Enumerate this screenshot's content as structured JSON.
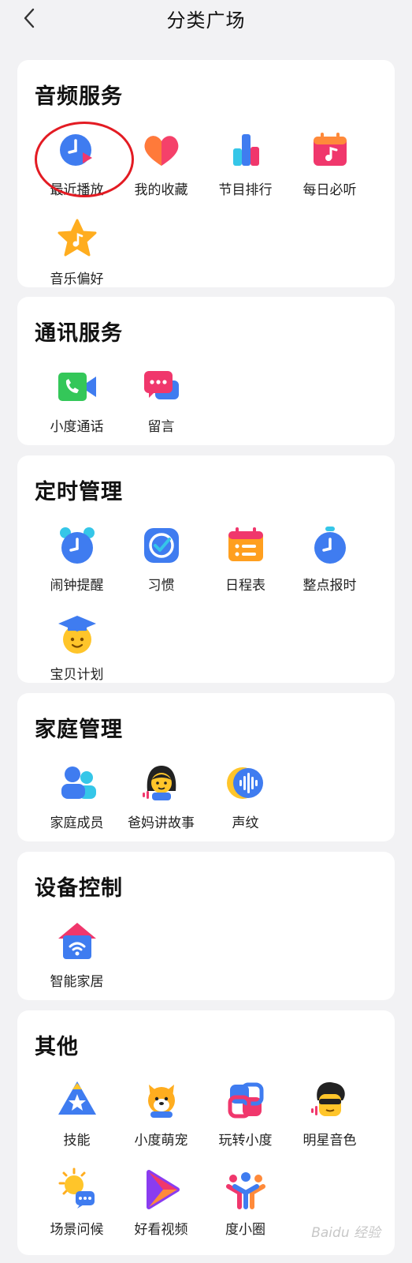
{
  "header": {
    "title": "分类广场"
  },
  "sections": [
    {
      "title": "音频服务",
      "items": [
        {
          "label": "最近播放",
          "icon": "clock-play-icon"
        },
        {
          "label": "我的收藏",
          "icon": "heart-icon"
        },
        {
          "label": "节目排行",
          "icon": "bar-chart-icon"
        },
        {
          "label": "每日必听",
          "icon": "calendar-music-icon"
        },
        {
          "label": "音乐偏好",
          "icon": "star-music-icon"
        }
      ]
    },
    {
      "title": "通讯服务",
      "items": [
        {
          "label": "小度通话",
          "icon": "video-call-icon"
        },
        {
          "label": "留言",
          "icon": "message-icon"
        }
      ]
    },
    {
      "title": "定时管理",
      "items": [
        {
          "label": "闹钟提醒",
          "icon": "alarm-clock-icon"
        },
        {
          "label": "习惯",
          "icon": "check-icon"
        },
        {
          "label": "日程表",
          "icon": "schedule-icon"
        },
        {
          "label": "整点报时",
          "icon": "stopwatch-icon"
        },
        {
          "label": "宝贝计划",
          "icon": "graduate-face-icon"
        }
      ]
    },
    {
      "title": "家庭管理",
      "items": [
        {
          "label": "家庭成员",
          "icon": "family-members-icon"
        },
        {
          "label": "爸妈讲故事",
          "icon": "storyteller-icon"
        },
        {
          "label": "声纹",
          "icon": "voiceprint-icon"
        }
      ]
    },
    {
      "title": "设备控制",
      "items": [
        {
          "label": "智能家居",
          "icon": "smart-home-icon"
        }
      ]
    },
    {
      "title": "其他",
      "items": [
        {
          "label": "技能",
          "icon": "skill-star-icon"
        },
        {
          "label": "小度萌宠",
          "icon": "pet-dog-icon"
        },
        {
          "label": "玩转小度",
          "icon": "play-tips-icon"
        },
        {
          "label": "明星音色",
          "icon": "star-voice-icon"
        },
        {
          "label": "场景问候",
          "icon": "sun-greeting-icon"
        },
        {
          "label": "好看视频",
          "icon": "video-play-icon"
        },
        {
          "label": "度小圈",
          "icon": "community-icon"
        }
      ]
    }
  ],
  "watermark": "Baidu 经验"
}
